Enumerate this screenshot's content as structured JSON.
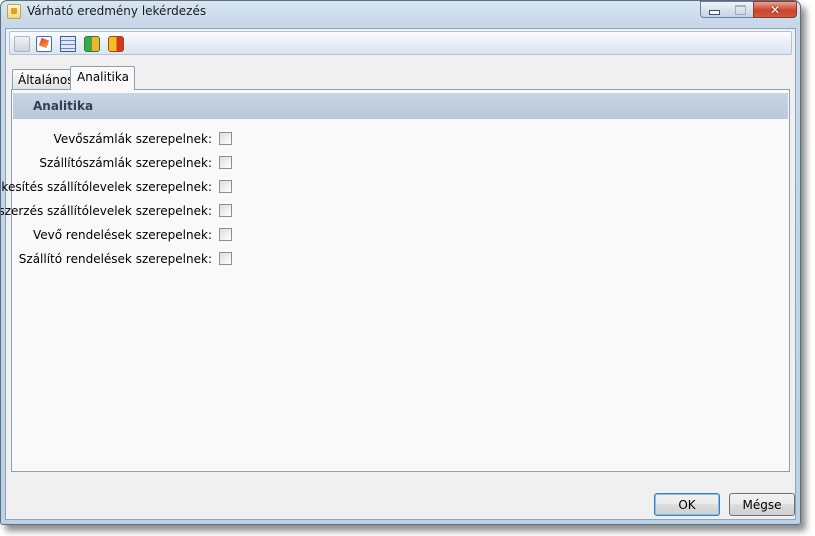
{
  "window": {
    "title": "Várható eredmény lekérdezés",
    "close_symbol": "✕",
    "icons": [
      "document-yellow-icon",
      "minimize-icon",
      "maximize-icon",
      "close-icon"
    ]
  },
  "toolbar": {
    "icons": [
      "copy-icon",
      "edit-icon",
      "calculator-icon",
      "open-book-icon",
      "export-icon"
    ]
  },
  "tabs": [
    {
      "label": "Általános",
      "active": false
    },
    {
      "label": "Analitika",
      "active": true
    }
  ],
  "section": {
    "title": "Analitika",
    "fields": [
      {
        "label": "Vevőszámlák szerepelnek:",
        "checked": false
      },
      {
        "label": "Szállítószámlák szerepelnek:",
        "checked": false
      },
      {
        "label": "Értékesítés szállítólevelek szerepelnek:",
        "checked": false
      },
      {
        "label": "Beszerzés szállítólevelek szerepelnek:",
        "checked": false
      },
      {
        "label": "Vevő rendelések szerepelnek:",
        "checked": false
      },
      {
        "label": "Szállító rendelések szerepelnek:",
        "checked": false
      }
    ]
  },
  "buttons": {
    "ok": "OK",
    "cancel": "Mégse"
  },
  "colors": {
    "section_header": "#bccbdc",
    "frame": "#c7d8ea",
    "close_button": "#c9452b"
  }
}
